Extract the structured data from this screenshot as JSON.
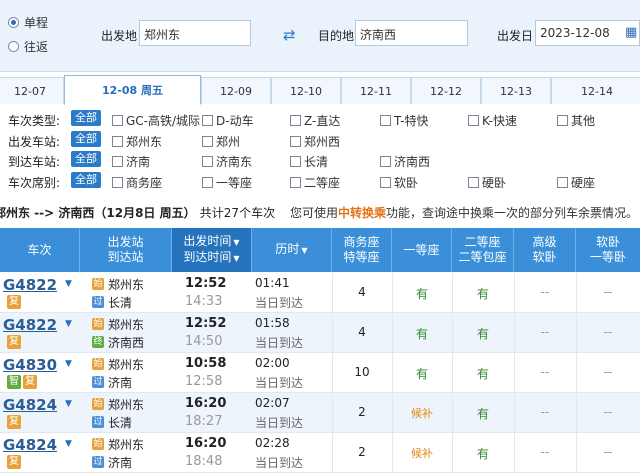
{
  "search": {
    "trip_types": [
      {
        "label": "单程",
        "checked": true
      },
      {
        "label": "往返",
        "checked": false
      }
    ],
    "from_label": "出发地",
    "from_value": "郑州东",
    "to_label": "目的地",
    "to_value": "济南西",
    "date_label": "出发日",
    "date_value": "2023-12-08"
  },
  "date_tabs": [
    "12-07",
    "12-08 周五",
    "12-09",
    "12-10",
    "12-11",
    "12-12",
    "12-13",
    "12-14"
  ],
  "active_date_index": 1,
  "filters": {
    "all_label": "全部",
    "train_type": {
      "label": "车次类型:",
      "options": [
        "GC-高铁/城际",
        "D-动车",
        "Z-直达",
        "T-特快",
        "K-快速",
        "其他"
      ]
    },
    "depart_station": {
      "label": "出发车站:",
      "options": [
        "郑州东",
        "郑州",
        "郑州西"
      ]
    },
    "arrive_station": {
      "label": "到达车站:",
      "options": [
        "济南",
        "济南东",
        "长清",
        "济南西"
      ]
    },
    "seat_class": {
      "label": "车次席别:",
      "options": [
        "商务座",
        "一等座",
        "二等座",
        "软卧",
        "硬卧",
        "硬座"
      ]
    }
  },
  "summary": {
    "route": "郑州东 --> 济南西（12月8日 周五）",
    "count": "共计27个车次",
    "tip_before": "您可使用",
    "tip_highlight": "中转换乘",
    "tip_after": "功能，查询途中换乘一次的部分列车余票情况。"
  },
  "table_headers": {
    "train": "车次",
    "station_1": "出发站",
    "station_2": "到达站",
    "time_1": "出发时间",
    "time_2": "到达时间",
    "duration": "历时",
    "business_1": "商务座",
    "business_2": "特等座",
    "first": "一等座",
    "second_1": "二等座",
    "second_2": "二等包座",
    "soft_1": "高级",
    "soft_2": "软卧",
    "soft2_1": "软卧",
    "soft2_2": "一等卧"
  },
  "rows": [
    {
      "train": "G4822",
      "badges": [
        "复"
      ],
      "from_icon": "始",
      "from": "郑州东",
      "to_icon": "过",
      "to": "长清",
      "depart": "12:52",
      "arrive": "14:33",
      "duration": "01:41",
      "arrive_day": "当日到达",
      "business": "4",
      "first": "有",
      "second": "有",
      "adv_soft": "--",
      "soft": "--"
    },
    {
      "train": "G4822",
      "badges": [
        "复"
      ],
      "from_icon": "始",
      "from": "郑州东",
      "to_icon": "终",
      "to": "济南西",
      "depart": "12:52",
      "arrive": "14:50",
      "duration": "01:58",
      "arrive_day": "当日到达",
      "business": "4",
      "first": "有",
      "second": "有",
      "adv_soft": "--",
      "soft": "--"
    },
    {
      "train": "G4830",
      "badges": [
        "智",
        "复"
      ],
      "from_icon": "始",
      "from": "郑州东",
      "to_icon": "过",
      "to": "济南",
      "depart": "10:58",
      "arrive": "12:58",
      "duration": "02:00",
      "arrive_day": "当日到达",
      "business": "10",
      "first": "有",
      "second": "有",
      "adv_soft": "--",
      "soft": "--"
    },
    {
      "train": "G4824",
      "badges": [
        "复"
      ],
      "from_icon": "始",
      "from": "郑州东",
      "to_icon": "过",
      "to": "长清",
      "depart": "16:20",
      "arrive": "18:27",
      "duration": "02:07",
      "arrive_day": "当日到达",
      "business": "2",
      "first": "候补",
      "second": "有",
      "adv_soft": "--",
      "soft": "--"
    },
    {
      "train": "G4824",
      "badges": [
        "复"
      ],
      "from_icon": "始",
      "from": "郑州东",
      "to_icon": "过",
      "to": "济南",
      "depart": "16:20",
      "arrive": "18:48",
      "duration": "02:28",
      "arrive_day": "当日到达",
      "business": "2",
      "first": "候补",
      "second": "有",
      "adv_soft": "--",
      "soft": "--"
    }
  ],
  "colors": {
    "accent": "#2a7bc8",
    "header_bg": "#3b8fd8",
    "available": "#2c8a2c",
    "waitlist": "#e08a18"
  }
}
